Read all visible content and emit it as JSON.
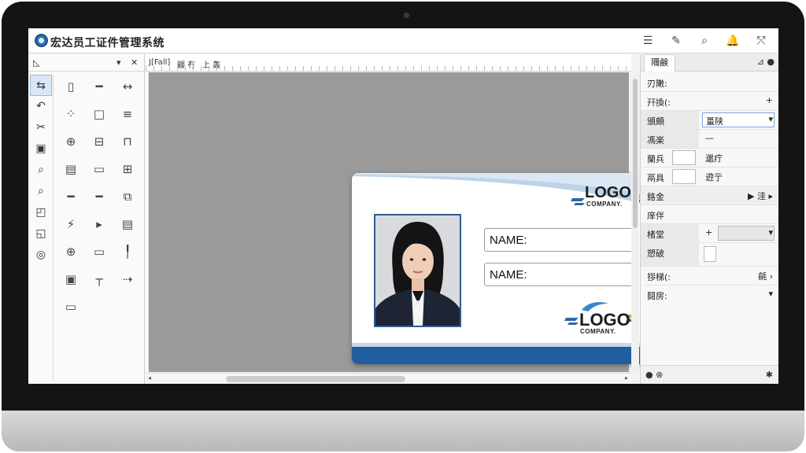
{
  "app": {
    "title": "宏达员工证件管理系统",
    "title_icons": [
      "list-icon",
      "edit-path-icon",
      "search-settings-icon",
      "bell-icon",
      "share-icon"
    ],
    "title_icon_glyphs": [
      "☰",
      "✎",
      "⌕",
      "🔔",
      "⤲"
    ]
  },
  "toolbox": {
    "head_left": "◺",
    "head_pin": "▾",
    "head_close": "✕",
    "tools_col_a": [
      "⇆",
      "↶",
      "✂",
      "▣",
      "⌕",
      "⌕",
      "◰",
      "◱",
      "◎"
    ],
    "tools_grid": [
      "▯",
      "━",
      "↔",
      "⁘",
      "□",
      "≡",
      "⊕",
      "⊟",
      "⊓",
      "▤",
      "▭",
      "⊞",
      "━",
      "━",
      "⧉",
      "⚡",
      "▸",
      "▤",
      "⊕",
      "▭",
      "╿",
      "▣",
      "┬",
      "⇢",
      "▭"
    ]
  },
  "ruler": {
    "label1": "J[Fall]",
    "label2": "鼹 冇",
    "label3": "上 轰"
  },
  "card": {
    "name_label_1": "NAME:",
    "name_label_2": "NAME:",
    "logo_top": "LOGO",
    "logo_top_sub": "COMPANY.",
    "logo_bottom": "LOGO",
    "logo_bottom_sub": "COMPANY.",
    "accent_color": "#1f5f9e",
    "wave_color": "#bcd3ea"
  },
  "props": {
    "tab": "隬鹸",
    "head_icons": "⊿ ●",
    "rows": [
      {
        "label": "刃敶:",
        "value": "",
        "right": ""
      },
      {
        "label": "幵換(:",
        "value": "",
        "right": "+"
      },
      {
        "label": "頒頗",
        "value": "畺陕",
        "right": "▾"
      },
      {
        "label": "馮楽",
        "value": "—",
        "right": ""
      },
      {
        "label": "蘭兵",
        "value": "",
        "right": "邋疔"
      },
      {
        "label": "鬲具",
        "value": "",
        "right": "逰亍"
      },
      {
        "label": "餎金",
        "value": "",
        "right": "▶ 洼 ▸"
      },
      {
        "label": "庠伴",
        "value": "",
        "right": ""
      },
      {
        "label": "楮堂",
        "value": "+",
        "right": "▾"
      },
      {
        "label": "愬破",
        "value": "",
        "right": ""
      },
      {
        "label": "拶梯(:",
        "value": "",
        "right": "毹 ›"
      },
      {
        "label": "鬪房:",
        "value": "",
        "right": "▾"
      }
    ],
    "bottom_left": "● ⊗",
    "bottom_right": "✱"
  }
}
